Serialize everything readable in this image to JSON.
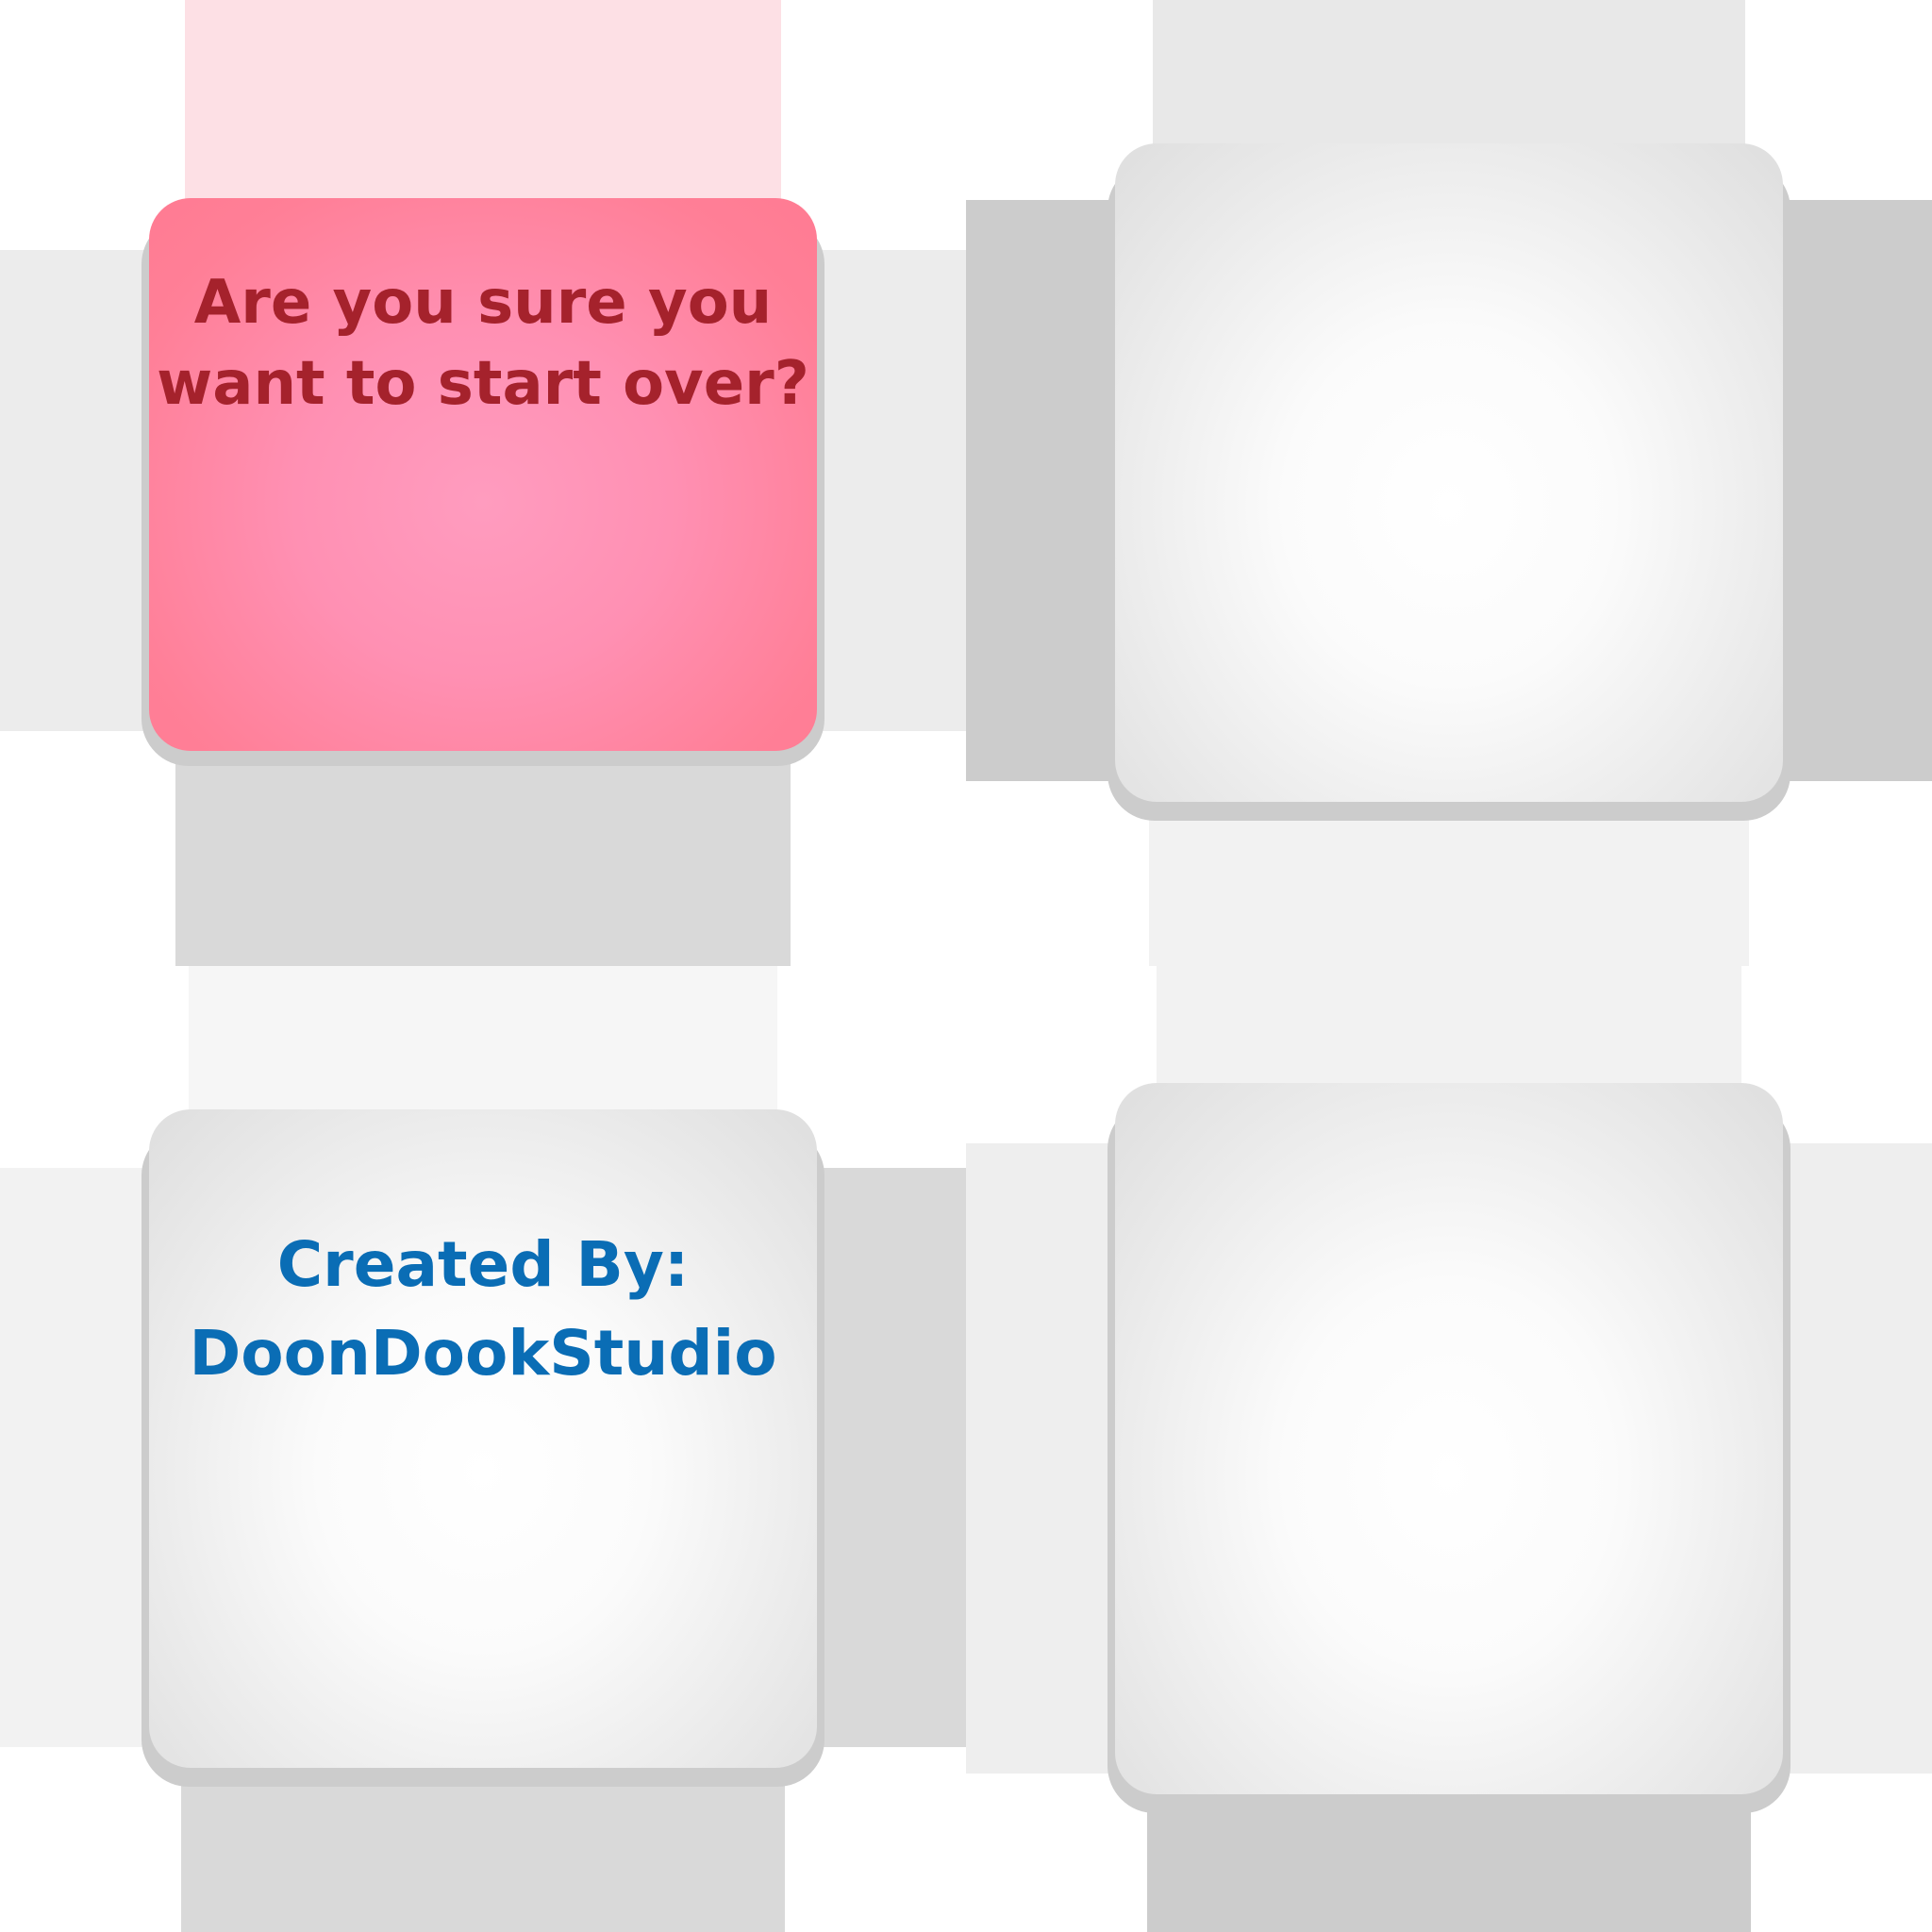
{
  "dialog": {
    "message": "Are you sure you want to start over?"
  },
  "credits": {
    "line1": "Created By:",
    "line2": "DoonDookStudio"
  },
  "colors": {
    "message_text": "#a5222c",
    "credit_text": "#0a6db5",
    "pink_tile": "#ff8aa6",
    "grey_tile": "#e6e6e6"
  }
}
